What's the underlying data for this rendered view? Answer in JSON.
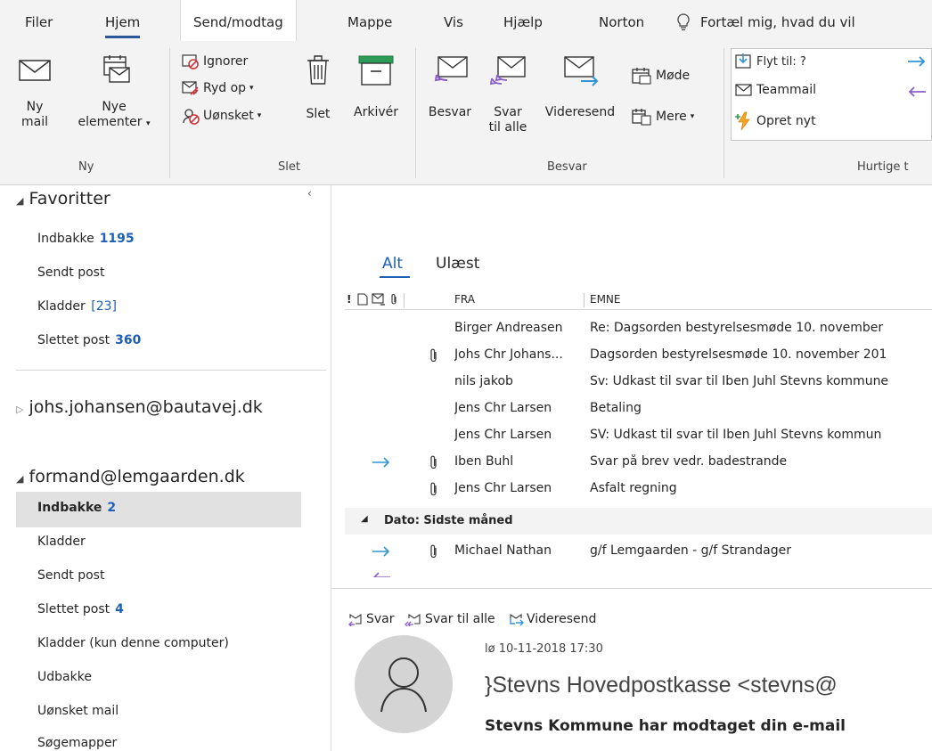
{
  "menu": {
    "tabs": [
      "Filer",
      "Hjem",
      "Send/modtag",
      "Mappe",
      "Vis",
      "Hjælp",
      "Norton"
    ],
    "tell_me": "Fortæl mig, hvad du vil"
  },
  "ribbon": {
    "new_mail": [
      "Ny",
      "mail"
    ],
    "new_items": [
      "Nye",
      "elementer"
    ],
    "ignore": "Ignorer",
    "cleanup": "Ryd op",
    "junk": "Uønsket",
    "delete": "Slet",
    "archive": "Arkivér",
    "reply": "Besvar",
    "reply_all": [
      "Svar",
      "til alle"
    ],
    "forward": "Videresend",
    "meeting": "Møde",
    "more": "Mere",
    "quick_steps": [
      "Flyt til: ?",
      "Teammail",
      "Opret nyt"
    ],
    "groups": [
      "Ny",
      "Slet",
      "Besvar",
      "Hurtige t"
    ]
  },
  "nav": {
    "favorites_title": "Favoritter",
    "favorites": [
      {
        "label": "Indbakke",
        "count": "1195"
      },
      {
        "label": "Sendt post",
        "count": ""
      },
      {
        "label": "Kladder",
        "count": "[23]"
      },
      {
        "label": "Slettet post",
        "count": "360"
      }
    ],
    "account1": "johs.johansen@bautavej.dk",
    "account2": "formand@lemgaarden.dk",
    "account2_items": [
      {
        "label": "Indbakke",
        "count": "2"
      },
      {
        "label": "Kladder",
        "count": ""
      },
      {
        "label": "Sendt post",
        "count": ""
      },
      {
        "label": "Slettet post",
        "count": "4"
      },
      {
        "label": "Kladder (kun denne computer)",
        "count": ""
      },
      {
        "label": "Udbakke",
        "count": ""
      },
      {
        "label": "Uønsket mail",
        "count": ""
      },
      {
        "label": "Søgemapper",
        "count": ""
      }
    ]
  },
  "list": {
    "tab_all": "Alt",
    "tab_unread": "Ulæst",
    "col_from": "FRA",
    "col_subject": "EMNE",
    "messages": [
      {
        "from": "Birger Andreasen",
        "subject": "Re: Dagsorden bestyrelsesmøde 10. november",
        "attachment": false,
        "forwarded": false
      },
      {
        "from": "Johs Chr Johans...",
        "subject": "Dagsorden bestyrelsesmøde 10. november 201",
        "attachment": true,
        "forwarded": false
      },
      {
        "from": "nils jakob",
        "subject": "Sv: Udkast til svar til Iben Juhl Stevns kommune",
        "attachment": false,
        "forwarded": false
      },
      {
        "from": "Jens Chr Larsen",
        "subject": "Betaling",
        "attachment": false,
        "forwarded": false
      },
      {
        "from": "Jens Chr Larsen",
        "subject": "SV: Udkast til svar til Iben Juhl Stevns kommun",
        "attachment": false,
        "forwarded": false
      },
      {
        "from": "Iben Buhl",
        "subject": "Svar på brev vedr. badestrande",
        "attachment": true,
        "forwarded": true
      },
      {
        "from": "Jens Chr Larsen",
        "subject": "Asfalt regning",
        "attachment": true,
        "forwarded": false
      }
    ],
    "group_header": "Dato: Sidste måned",
    "group_messages": [
      {
        "from": "Michael Nathan",
        "subject": "g/f Lemgaarden - g/f Strandager",
        "attachment": true,
        "forwarded": true
      }
    ]
  },
  "reader": {
    "reply": "Svar",
    "reply_all": "Svar til alle",
    "forward": "Videresend",
    "date": "lø 10-11-2018 17:30",
    "sender": "}Stevns Hovedpostkasse <stevns@",
    "subject": "Stevns Kommune har modtaget din e-mail"
  },
  "colors": {
    "accent": "#2b579a",
    "count_blue": "#1f5fb5",
    "arrow_blue": "#2f95d8",
    "arrow_purple": "#8a5fc6"
  }
}
